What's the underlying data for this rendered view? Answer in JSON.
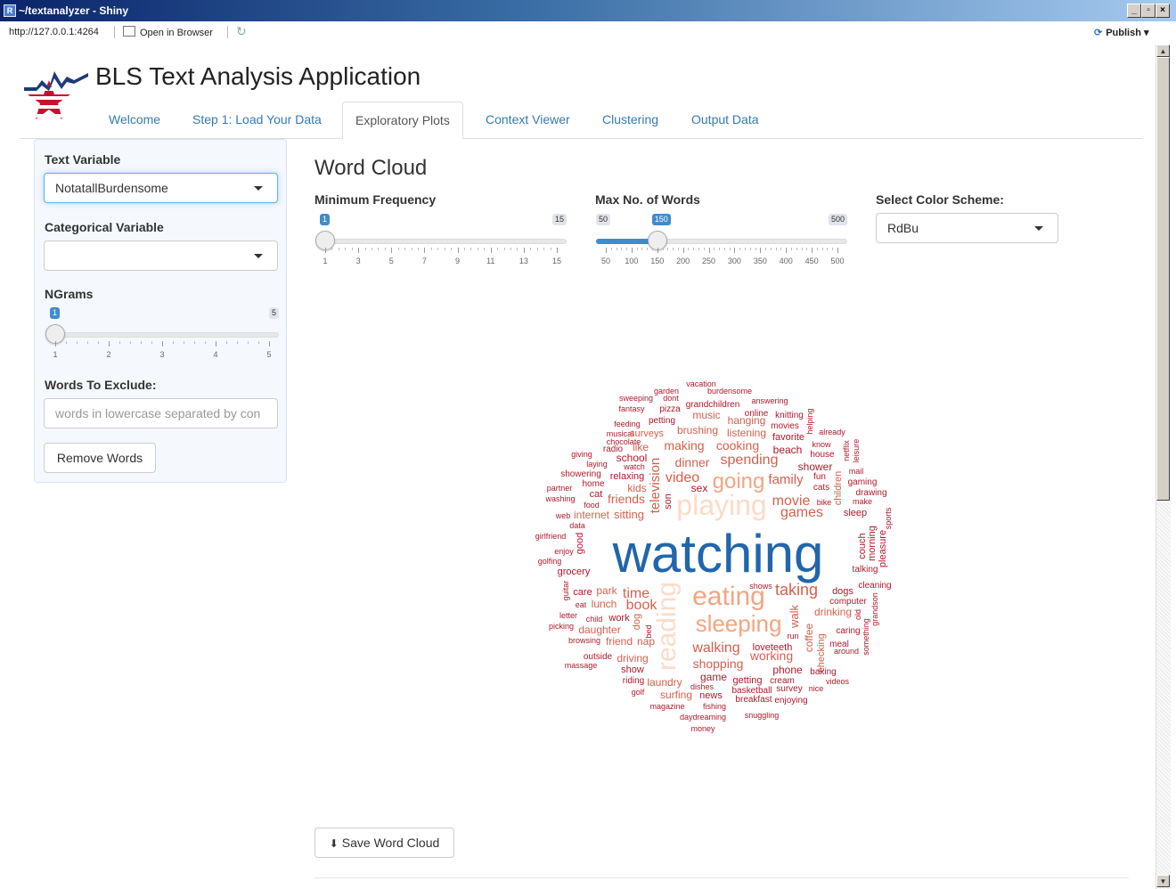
{
  "window": {
    "title": "~/textanalyzer - Shiny",
    "url": "http://127.0.0.1:4264",
    "open_browser_label": "Open in Browser",
    "publish_label": "Publish"
  },
  "app": {
    "title": "BLS Text Analysis Application"
  },
  "tabs": [
    "Welcome",
    "Step 1: Load Your Data",
    "Exploratory Plots",
    "Context Viewer",
    "Clustering",
    "Output Data"
  ],
  "active_tab": "Exploratory Plots",
  "sidebar": {
    "text_variable_label": "Text Variable",
    "text_variable_value": "NotatallBurdensome",
    "categorical_variable_label": "Categorical Variable",
    "categorical_variable_value": "",
    "ngrams_label": "NGrams",
    "ngrams": {
      "min": 1,
      "max": 5,
      "value": 1,
      "tick_labels": [
        "1",
        "2",
        "3",
        "4",
        "5"
      ]
    },
    "exclude_label": "Words To Exclude:",
    "exclude_placeholder": "words in lowercase separated by con",
    "remove_button": "Remove Words"
  },
  "main": {
    "heading": "Word Cloud",
    "min_freq": {
      "label": "Minimum Frequency",
      "min": 1,
      "max": 15,
      "value": 1,
      "tick_labels": [
        "1",
        "3",
        "5",
        "7",
        "9",
        "11",
        "13",
        "15"
      ]
    },
    "max_words": {
      "label": "Max No. of Words",
      "min": 50,
      "max": 500,
      "value": 150,
      "tick_labels": [
        "50",
        "100",
        "150",
        "200",
        "250",
        "300",
        "350",
        "400",
        "450",
        "500"
      ]
    },
    "color_scheme": {
      "label": "Select Color Scheme:",
      "value": "RdBu"
    },
    "save_button": "Save Word Cloud"
  },
  "wordcloud_words": [
    "vacation",
    "garden",
    "burdensome",
    "sweeping",
    "dont",
    "answering",
    "fantasy",
    "pizza",
    "grandchildren",
    "online",
    "knitting",
    "feeding",
    "petting",
    "music",
    "hanging",
    "movies",
    "helping",
    "musical",
    "surveys",
    "brushing",
    "listening",
    "favorite",
    "already",
    "chocolate",
    "know",
    "netflix",
    "leisure",
    "radio",
    "like",
    "making",
    "cooking",
    "beach",
    "house",
    "giving",
    "school",
    "spending",
    "shower",
    "laying",
    "watch",
    "mail",
    "showering",
    "relaxing",
    "video",
    "going",
    "family",
    "fun",
    "gaming",
    "television",
    "children",
    "home",
    "dinner",
    "drawing",
    "partner",
    "cat",
    "kids",
    "sex",
    "cats",
    "washing",
    "friends",
    "son",
    "playing",
    "movie",
    "bike",
    "make",
    "food",
    "web",
    "internet",
    "sitting",
    "games",
    "sleep",
    "sports",
    "data",
    "girlfriend",
    "good",
    "watching",
    "couch",
    "morning",
    "pleasure",
    "enjoy",
    "golfing",
    "talking",
    "grocery",
    "shows",
    "cleaning",
    "guitar",
    "care",
    "park",
    "time",
    "taking",
    "dogs",
    "grandson",
    "eat",
    "lunch",
    "book",
    "eating",
    "computer",
    "letter",
    "reading",
    "walk",
    "drinking",
    "old",
    "child",
    "work",
    "dog",
    "picking",
    "daughter",
    "bed",
    "sleeping",
    "coffee",
    "caring",
    "something",
    "browsing",
    "friend",
    "nap",
    "run",
    "meal",
    "loveteeth",
    "around",
    "outside",
    "walking",
    "working",
    "checking",
    "massage",
    "driving",
    "shopping",
    "phone",
    "baking",
    "show",
    "game",
    "getting",
    "cream",
    "videos",
    "riding",
    "laundry",
    "dishes",
    "basketball",
    "survey",
    "nice",
    "golf",
    "surfing",
    "news",
    "breakfast",
    "enjoying",
    "magazine",
    "fishing",
    "daydreaming",
    "snuggling",
    "money"
  ],
  "colors": {
    "accent": "#337ab7",
    "slider_fill": "#428bca",
    "cloud_dark_red": "#b2182b",
    "cloud_red": "#d6604d",
    "cloud_salmon": "#f4a582",
    "cloud_peach": "#fddbc7",
    "cloud_blue": "#2166ac"
  },
  "icons": {
    "window_icon": "r-icon",
    "open_browser": "browser-icon",
    "refresh": "refresh-icon",
    "publish": "publish-icon",
    "save": "download-icon"
  }
}
